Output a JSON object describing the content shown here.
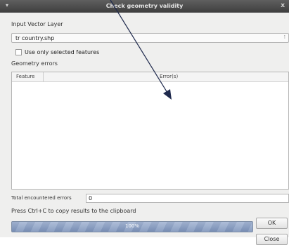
{
  "window": {
    "title": "Check geometry validity",
    "menu_glyph": "▾",
    "close_glyph": "x"
  },
  "form": {
    "input_layer_label": "Input Vector Layer",
    "input_layer_value": "tr country.shp",
    "use_selected_label": "Use only selected features",
    "use_selected_checked": false,
    "geometry_errors_label": "Geometry errors"
  },
  "table": {
    "columns": [
      "Feature",
      "Error(s)"
    ],
    "rows": []
  },
  "summary": {
    "total_errors_label": "Total encountered errors",
    "total_errors_value": "0",
    "clipboard_hint": "Press Ctrl+C to copy results to the clipboard"
  },
  "buttons": {
    "ok_label": "OK",
    "close_label": "Close"
  },
  "progress": {
    "value_percent": 100,
    "label": "100%"
  },
  "icons": {
    "combo_arrow": "spinner-arrows-icon",
    "annotation": "arrow-pointer-icon"
  },
  "colors": {
    "titlebar": "#4e4e4e",
    "dialog_bg": "#efefee",
    "progress": "#8aa0c6",
    "annotation_arrow": "#1f2a4d"
  }
}
